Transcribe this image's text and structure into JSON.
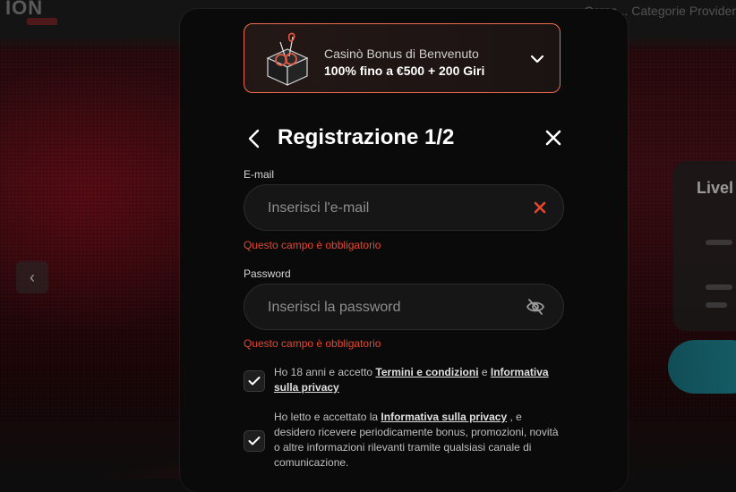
{
  "background": {
    "logo_text": "ION",
    "top_nav_text": "Cerca... Categorie  Provider",
    "side_panel_title": "Livel"
  },
  "bonus": {
    "title": "Casinò Bonus di Benvenuto",
    "amount": "100% fino a €500 + 200 Giri",
    "border_color": "#ef6b4d"
  },
  "header": {
    "title": "Registrazione 1/2"
  },
  "email": {
    "label": "E-mail",
    "placeholder": "Inserisci l'e-mail",
    "value": "",
    "error": "Questo campo è obbligatorio"
  },
  "password": {
    "label": "Password",
    "placeholder": "Inserisci la password",
    "value": "",
    "error": "Questo campo è obbligatorio"
  },
  "consents": {
    "age": {
      "checked": true,
      "text_prefix": "Ho 18 anni e accetto ",
      "terms_link": "Termini e condizioni",
      "text_mid": " e ",
      "privacy_link": "Informativa sulla privacy"
    },
    "marketing": {
      "checked": true,
      "text_prefix": "Ho letto e accettato la ",
      "privacy_link": "Informativa sulla privacy",
      "text_suffix": " , e desidero ricevere periodicamente bonus, promozioni, novità o altre informazioni rilevanti tramite qualsiasi canale di comunicazione."
    }
  },
  "colors": {
    "error": "#e8452f",
    "accent": "#ef6b4d"
  }
}
